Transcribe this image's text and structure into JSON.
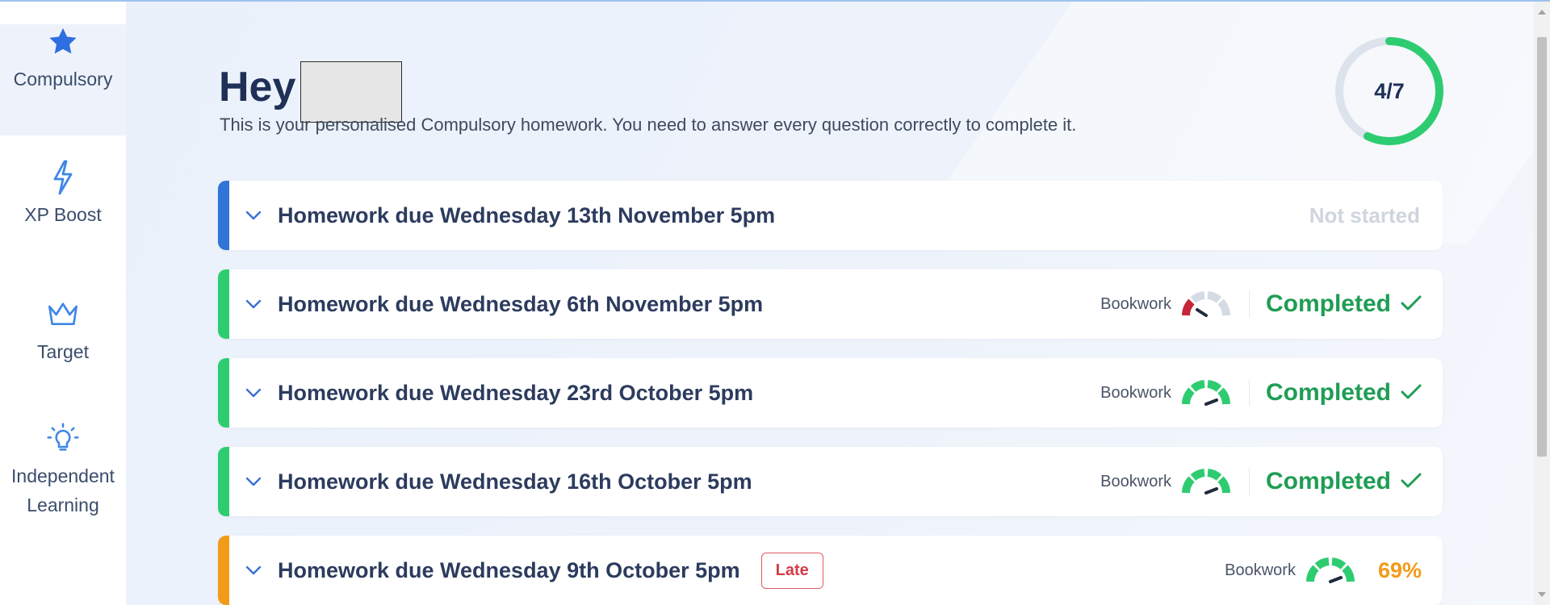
{
  "sidebar": {
    "items": [
      {
        "label": "Compulsory",
        "icon": "star-icon",
        "active": true
      },
      {
        "label": "XP Boost",
        "icon": "lightning-icon",
        "active": false
      },
      {
        "label": "Target",
        "icon": "crown-icon",
        "active": false
      },
      {
        "label": "Independent Learning",
        "icon": "lightbulb-icon",
        "active": false
      }
    ]
  },
  "header": {
    "greeting": "Hey",
    "subtitle": "This is your personalised Compulsory homework. You need to answer every question correctly to complete it."
  },
  "progress": {
    "label": "4/7",
    "completed": 4,
    "total": 7,
    "color": "#2ecc71"
  },
  "homework": [
    {
      "title": "Homework due Wednesday 13th November 5pm",
      "status": "Not started",
      "accent": "#2f74d6",
      "bookwork_label": null,
      "gauge": null,
      "late": false
    },
    {
      "title": "Homework due Wednesday 6th November 5pm",
      "status": "Completed",
      "accent": "#2ecc71",
      "bookwork_label": "Bookwork",
      "gauge": "low",
      "late": false
    },
    {
      "title": "Homework due Wednesday 23rd October 5pm",
      "status": "Completed",
      "accent": "#2ecc71",
      "bookwork_label": "Bookwork",
      "gauge": "high",
      "late": false
    },
    {
      "title": "Homework due Wednesday 16th October 5pm",
      "status": "Completed",
      "accent": "#2ecc71",
      "bookwork_label": "Bookwork",
      "gauge": "high",
      "late": false
    },
    {
      "title": "Homework due Wednesday 9th October 5pm",
      "status": "69%",
      "accent": "#f29b18",
      "bookwork_label": "Bookwork",
      "gauge": "high",
      "late": true,
      "late_label": "Late"
    }
  ],
  "colors": {
    "completed": "#1f9d55",
    "late": "#d23c48",
    "percent": "#f29b18",
    "title": "#1f3056"
  }
}
